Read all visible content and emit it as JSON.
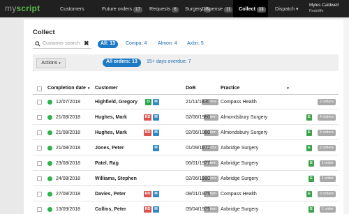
{
  "app": {
    "logo_my": "my",
    "logo_script": "script"
  },
  "nav": [
    {
      "label": "Customers",
      "badge": ""
    },
    {
      "label": "Future orders",
      "badge": "17"
    },
    {
      "label": "Requests",
      "badge": "6"
    },
    {
      "label": "Surgery",
      "badge": "7"
    },
    {
      "label": "Dispense",
      "badge": "11"
    },
    {
      "label": "Collect",
      "badge": "13"
    },
    {
      "label": "Dispatch",
      "badge": ""
    }
  ],
  "dispatch_caret": "▾",
  "user": {
    "name": "Myles Caldwell",
    "location": "Redcliffe"
  },
  "page": {
    "title": "Collect"
  },
  "search": {
    "placeholder": "Customer search",
    "clear": "✖"
  },
  "filters": [
    {
      "label": "All: 13",
      "active": true
    },
    {
      "label": "Compa: 4",
      "active": false
    },
    {
      "label": "Almon: 4",
      "active": false
    },
    {
      "label": "Axbri: 5",
      "active": false
    }
  ],
  "toolbar": {
    "actions_label": "Actions",
    "actions_caret": "▾",
    "toggles": [
      {
        "label": "All orders: 13",
        "active": true
      },
      {
        "label": "15+ days overdue: 7",
        "active": false
      }
    ]
  },
  "columns": {
    "completion": "Completion date",
    "completion_sort": "▾",
    "customer": "Customer",
    "dob": "DoB",
    "practice": "Practice",
    "practice_sort": "▾"
  },
  "rows": [
    {
      "date": "12/07/2018",
      "customer": "Highfield, Gregory",
      "tags": [
        "O",
        "M"
      ],
      "items": "2 items",
      "dob": "21/11/1935",
      "practice": "Compass Health",
      "e": false,
      "orders": "2 orders"
    },
    {
      "date": "21/08/2018",
      "customer": "Hughes, Mark",
      "tags": [
        "RD",
        "M"
      ],
      "items": "1 item",
      "dob": "02/06/1980",
      "practice": "Almondsbury Surgery",
      "e": true,
      "orders": "4 orders"
    },
    {
      "date": "21/08/2018",
      "customer": "Hughes, Mark",
      "tags": [
        "RD",
        "M"
      ],
      "items": "1 item",
      "dob": "02/06/1980",
      "practice": "Almondsbury Surgery",
      "e": true,
      "orders": "4 orders"
    },
    {
      "date": "21/08/2018",
      "customer": "Jones, Peter",
      "tags": [
        "M"
      ],
      "items": "2 items",
      "dob": "01/09/1972",
      "practice": "Axbridge Surgery",
      "e": true,
      "orders": "2 orders"
    },
    {
      "date": "23/08/2018",
      "customer": "Patel, Rag",
      "tags": [],
      "items": "1 item",
      "dob": "06/01/1977",
      "practice": "Axbridge Surgery",
      "e": true,
      "orders": "1 order"
    },
    {
      "date": "24/08/2018",
      "customer": "Williams, Stephen",
      "tags": [],
      "items": "2 items",
      "dob": "02/06/1980",
      "practice": "Axbridge Surgery",
      "e": true,
      "orders": "1 order"
    },
    {
      "date": "27/08/2018",
      "customer": "Davies, Peter",
      "tags": [
        "RD",
        "M"
      ],
      "items": "1 item",
      "dob": "08/01/1975",
      "practice": "Compass Health",
      "e": true,
      "orders": "3 orders"
    },
    {
      "date": "13/09/2018",
      "customer": "Collins, Peter",
      "tags": [
        "RD",
        "M"
      ],
      "items": "1 item",
      "dob": "05/04/1975",
      "practice": "Axbridge Surgery",
      "e": true,
      "orders": "1 order"
    }
  ],
  "colors": {
    "accent": "#1e79c4",
    "status_green": "#2fb34a",
    "tag_red": "#d9534f",
    "tag_blue": "#2e88c6"
  }
}
